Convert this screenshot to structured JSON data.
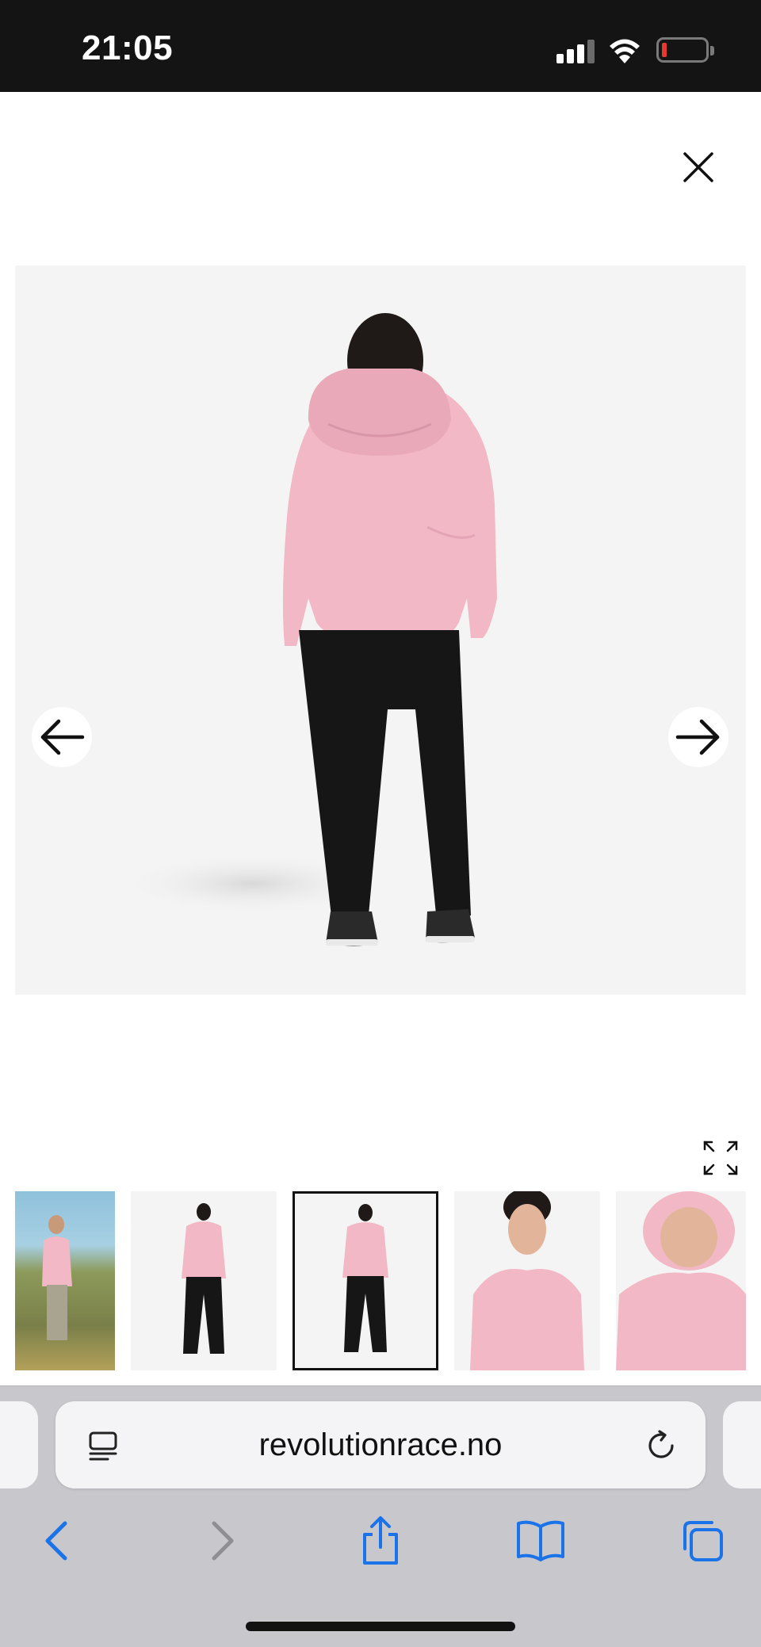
{
  "status_bar": {
    "time": "21:05",
    "icons": [
      "cellular-signal-icon",
      "wifi-icon",
      "battery-low-icon"
    ],
    "battery_color": "#e43a2f"
  },
  "gallery": {
    "close_icon": "close-icon",
    "prev_icon": "arrow-left-icon",
    "next_icon": "arrow-right-icon",
    "expand_icon": "expand-icon",
    "selected_index": 2,
    "thumbnails": [
      {
        "name": "outdoor-hiking-photo"
      },
      {
        "name": "front-studio-photo"
      },
      {
        "name": "back-studio-photo"
      },
      {
        "name": "hood-closeup-photo"
      },
      {
        "name": "hood-up-closeup-photo"
      }
    ],
    "jacket_color": "#f2b8c6"
  },
  "browser": {
    "url": "revolutionrace.no",
    "accent": "#1a73e8",
    "toolbar": [
      "back-icon",
      "forward-icon",
      "share-icon",
      "bookmarks-icon",
      "tabs-icon"
    ]
  }
}
